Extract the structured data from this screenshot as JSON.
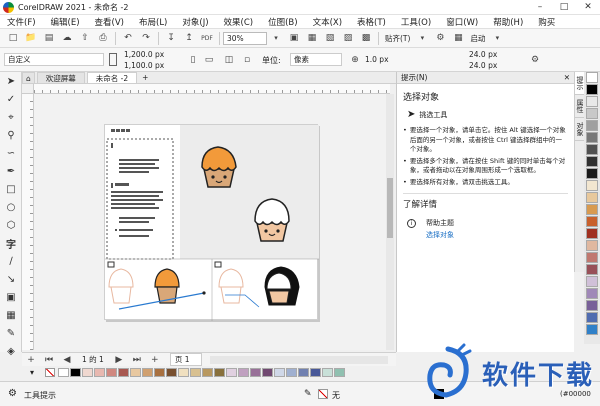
{
  "window": {
    "title": "CorelDRAW 2021 - 未命名 -2"
  },
  "menu": [
    "文件(F)",
    "编辑(E)",
    "查看(V)",
    "布局(L)",
    "对象(J)",
    "效果(C)",
    "位图(B)",
    "文本(X)",
    "表格(T)",
    "工具(O)",
    "窗口(W)",
    "帮助(H)",
    "购买"
  ],
  "toolbar": {
    "zoom": "30%",
    "snap_label": "贴齐(T)",
    "launch_label": "启动"
  },
  "propbar": {
    "preset": "自定义",
    "width": "1,200.0 px",
    "height": "1,100.0 px",
    "unit_label": "单位:",
    "unit": "像素",
    "nudge": "1.0 px",
    "dup_x": "24.0 px",
    "dup_y": "24.0 px"
  },
  "tabs": {
    "welcome": "欢迎屏幕",
    "doc": "未命名 -2"
  },
  "docker": {
    "header": "提示(N)",
    "section_title": "选择对象",
    "tool_name": "挑选工具",
    "bullets": [
      "要选择一个对象，请单击它。按住 Alt 键选择一个对象后面的另一个对象，或者按住 Ctrl 键选择群组中的一个对象。",
      "要选择多个对象，请在按住 Shift 键的同时单击每个对象，或者拖动以在对象周围形成一个选取框。",
      "要选择所有对象，请双击挑选工具。"
    ],
    "learn_more": "了解详情",
    "help_title": "帮助主题",
    "help_link": "选择对象"
  },
  "sidetabs": [
    "提示",
    "属性",
    "对象"
  ],
  "pagenav": {
    "info": "1 的 1",
    "page": "页 1"
  },
  "status": {
    "tool_hint": "工具提示",
    "fill_none": "无",
    "color_code": "(#00000"
  },
  "watermark": "软件下载",
  "colors": {
    "accent": "#1a6fc4",
    "palette_right": [
      "#ffffff",
      "#000000",
      "#e8e8e8",
      "#c8c8c8",
      "#a0a0a0",
      "#787878",
      "#505050",
      "#303030",
      "#1a1a1a",
      "#f2e6d0",
      "#e8c89c",
      "#d89a50",
      "#c8602c",
      "#a03020",
      "#e0b8a0",
      "#c07870",
      "#985058",
      "#d0c0d8",
      "#a088b8",
      "#786098",
      "#506cb0",
      "#3080c8"
    ],
    "palette_bottom": [
      "#ffffff",
      "#000000",
      "#f0d8d0",
      "#e8b8b0",
      "#d08880",
      "#a85850",
      "#e8c8a0",
      "#d0a070",
      "#a87040",
      "#785030",
      "#f0e0c0",
      "#d8c090",
      "#b89860",
      "#88703c",
      "#e0d0e0",
      "#c0a0c0",
      "#987098",
      "#704870",
      "#d0d8e8",
      "#a0b0d0",
      "#7080b0",
      "#485898",
      "#c8e0d8",
      "#90c0b0"
    ]
  }
}
